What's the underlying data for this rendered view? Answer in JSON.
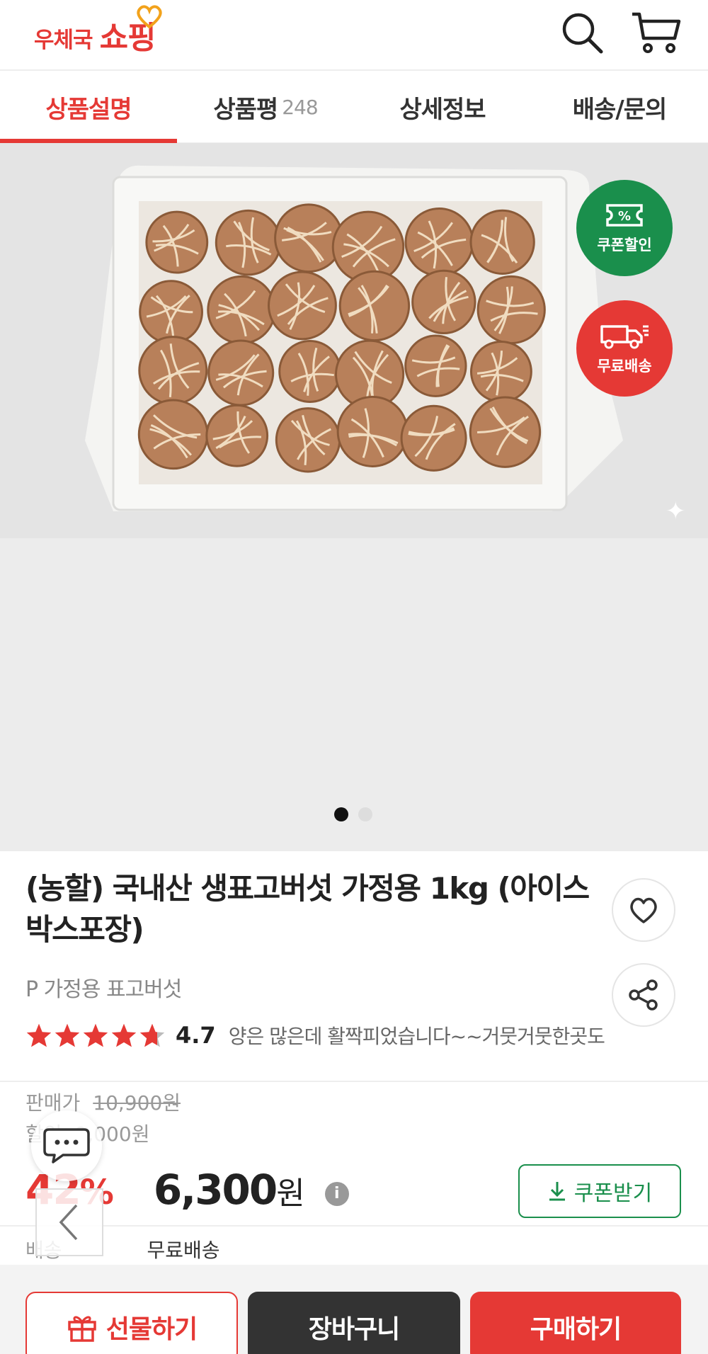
{
  "header": {
    "logo_prefix": "우체국",
    "logo_main": "쇼핑",
    "icons": [
      "search-icon",
      "cart-icon"
    ]
  },
  "tabs": [
    {
      "label": "상품설명",
      "active": true
    },
    {
      "label": "상품평",
      "count": "248"
    },
    {
      "label": "상세정보"
    },
    {
      "label": "배송/문의"
    }
  ],
  "gallery": {
    "image_desc_icon": "product-photo",
    "badges": {
      "coupon": "쿠폰할인",
      "shipping": "무료배송",
      "coupon_symbol": "%"
    },
    "current_slide": 1,
    "total_slides": 2
  },
  "product": {
    "title": "(농할) 국내산 생표고버섯 가정용 1kg (아이스박스포장)",
    "subtitle": "P 가정용 표고버섯",
    "rating": "4.7",
    "rating_value": 4.7,
    "review_snippet": "양은 많은데 활짝피었습니다~~거뭇거뭇한곳도"
  },
  "price": {
    "list_label": "판매가",
    "list_price": "10,900원",
    "discount_label": "할인",
    "discount_amount": "9,000원",
    "percent": "42",
    "percent_unit": "%",
    "final_price": "6,300",
    "final_unit": "원",
    "info_symbol": "i",
    "coupon_button": "쿠폰받기"
  },
  "shipping": {
    "label": "배송",
    "value": "무료배송"
  },
  "bottom_bar": {
    "gift": "선물하기",
    "cart": "장바구니",
    "buy": "구매하기"
  },
  "colors": {
    "brand_red": "#e53935",
    "coupon_green": "#1a8f4c",
    "dark": "#333333"
  }
}
